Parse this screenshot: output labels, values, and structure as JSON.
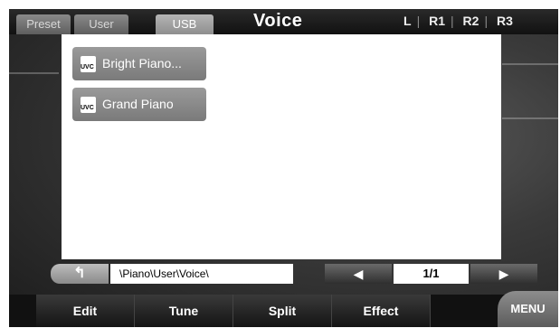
{
  "tabs": [
    {
      "label": "Preset",
      "active": false
    },
    {
      "label": "User",
      "active": false
    },
    {
      "label": "USB",
      "active": true
    }
  ],
  "title": "Voice",
  "zones": [
    "L",
    "R1",
    "R2",
    "R3"
  ],
  "files": [
    {
      "label": "Bright Piano...",
      "icon": "uvc-file-icon"
    },
    {
      "label": "Grand Piano",
      "icon": "uvc-file-icon"
    }
  ],
  "icon_text": "UVC",
  "path": "\\Piano\\User\\Voice\\",
  "back_icon": "↰",
  "page": "1/1",
  "prev_icon": "◀",
  "next_icon": "▶",
  "bottom": {
    "edit": "Edit",
    "tune": "Tune",
    "split": "Split",
    "effect": "Effect",
    "menu": "MENU"
  }
}
